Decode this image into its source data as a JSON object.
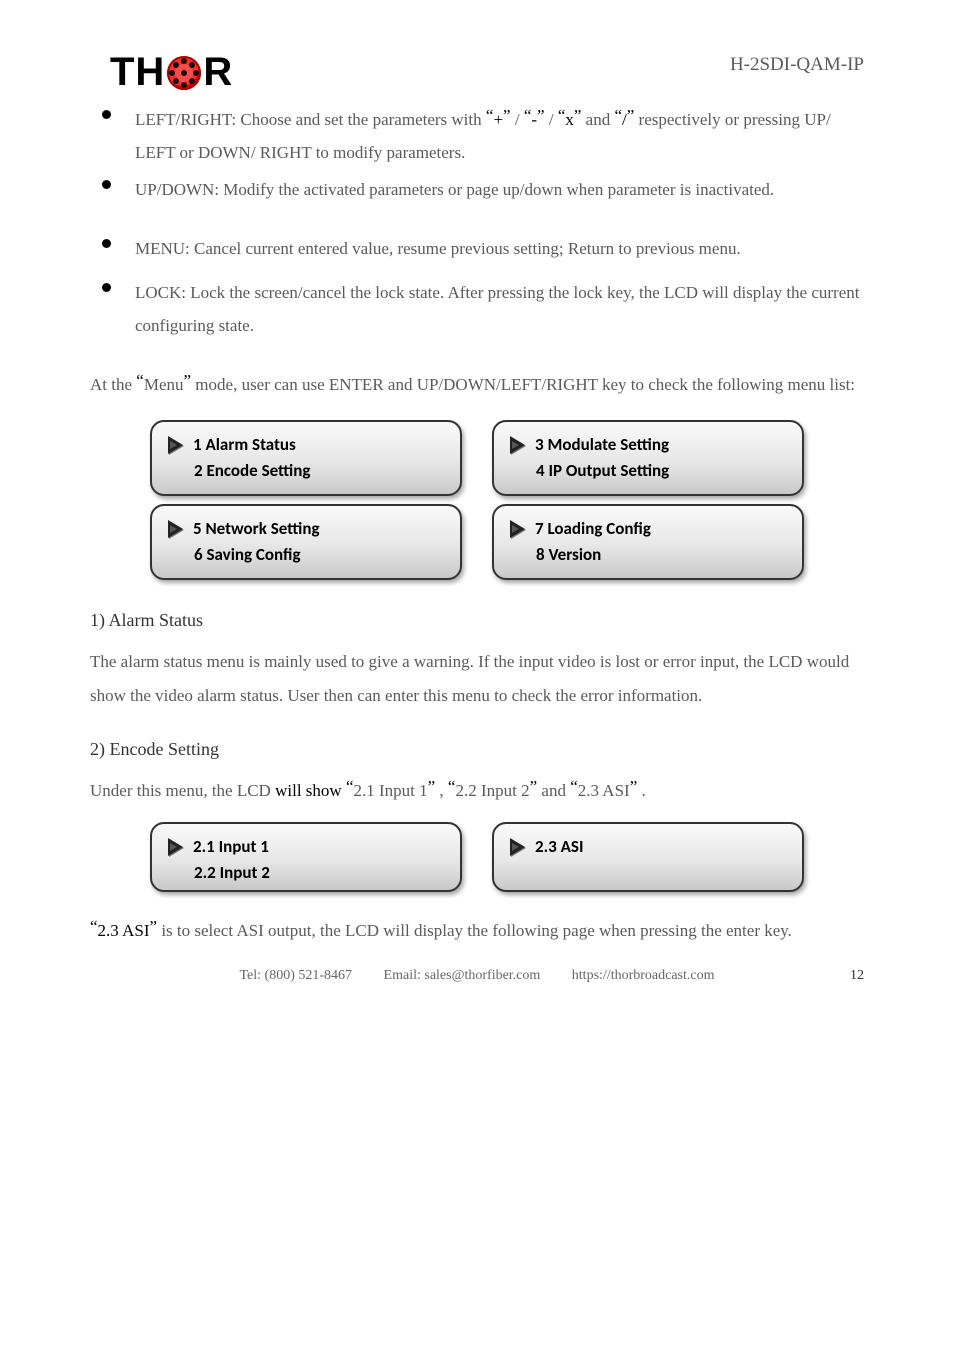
{
  "product_line": "H-2SDI-QAM-IP",
  "logo": {
    "part1": "TH",
    "part2": "R"
  },
  "bullets": [
    {
      "pre": "LEFT/RIGHT: Choose and set the parameters with ",
      "quote1": "“",
      "k1": "+",
      "quote2": "”",
      "sep1": " / ",
      "quote3": "“",
      "k2": "-",
      "quote4": "”",
      "sep2": " / ",
      "quote5": "“",
      "k3": "x",
      "quote6": "”",
      "mid": " and ",
      "quote7": "“",
      "k4": "/",
      "quote8": "”",
      "post": " respectively or pressing UP/ LEFT or DOWN/ RIGHT to modify parameters."
    },
    {
      "text": "UP/DOWN: Modify the activated parameters or page up/down when parameter is inactivated."
    },
    {
      "text": "MENU: Cancel current entered value, resume previous setting; Return to previous menu."
    },
    {
      "text": "LOCK: Lock the screen/cancel the lock state. After pressing the lock key, the LCD will display the current configuring state."
    }
  ],
  "para1_a": "At the ",
  "para1_q1": "“",
  "para1_b": "Menu",
  "para1_q2": "”",
  "para1_c": " mode, user can use ENTER and UP/DOWN/LEFT/RIGHT key to check the following menu list:",
  "menu": {
    "g1": {
      "a": "1 Alarm Status",
      "b": "2 Encode Setting"
    },
    "g2": {
      "a": "3 Modulate Setting",
      "b": "4 IP Output Setting"
    },
    "g3": {
      "a": "5 Network Setting",
      "b": "6 Saving Config"
    },
    "g4": {
      "a": "7 Loading Config",
      "b": "8 Version"
    }
  },
  "alarm_hd": "1) Alarm Status",
  "alarm_p": "The alarm status menu is mainly used to give a warning. If the input video is lost or error input, the LCD would show the video alarm status. User then can enter this menu to check the error information.",
  "enc_hd": "2) Encode Setting",
  "enc_p_pre": "Under this menu, the LCD ",
  "enc_p_will": "will show ",
  "enc_q1": "“",
  "enc_v1": "2.1 Input 1",
  "enc_q2": "”",
  "enc_sp1": ", ",
  "enc_q3": "“",
  "enc_v2": "2.2 Input 2",
  "enc_q4": "”",
  "enc_and": " and ",
  "enc_q5": "“",
  "enc_v3": "2.3 ASI",
  "enc_q6": "”",
  "enc_post": ".",
  "menu2": {
    "g1": {
      "a": "2.1 Input 1",
      "b": "2.2 Input 2"
    },
    "g2": {
      "a": "2.3 ASI"
    }
  },
  "asi_note_a": "“",
  "asi_note_b": "2.3 ASI",
  "asi_note_c": "”",
  "asi_note_d": " is to select ASI output, the LCD will display the following page when pressing the enter key.",
  "footer_a": "Tel: (800) 521-8467",
  "footer_b": "Email: sales@thorfiber.com",
  "footer_c": "https://thorbroadcast.com",
  "page_num": "12"
}
